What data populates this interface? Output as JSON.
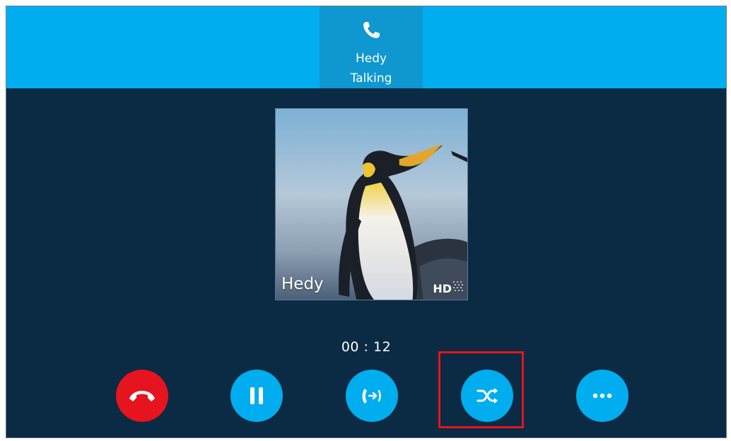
{
  "call": {
    "name": "Hedy",
    "status": "Talking",
    "tab_icon": "phone-icon"
  },
  "contact_card": {
    "name": "Hedy",
    "hd_label": "HD",
    "photo": "penguin-photo"
  },
  "timer": "00 : 12",
  "actions": [
    {
      "name": "end-call",
      "icon": "phone-hangup-icon",
      "color": "#e5141e"
    },
    {
      "name": "hold",
      "icon": "pause-icon",
      "color": "#00aeef"
    },
    {
      "name": "transfer",
      "icon": "transfer-icon",
      "color": "#00aeef"
    },
    {
      "name": "swap",
      "icon": "shuffle-icon",
      "color": "#00aeef",
      "highlighted": true
    },
    {
      "name": "more",
      "icon": "more-dots-icon",
      "color": "#00aeef"
    }
  ],
  "colors": {
    "header": "#00aeef",
    "active_tab": "#0f97d0",
    "background": "#0b2a44",
    "highlight": "#e8141b"
  }
}
